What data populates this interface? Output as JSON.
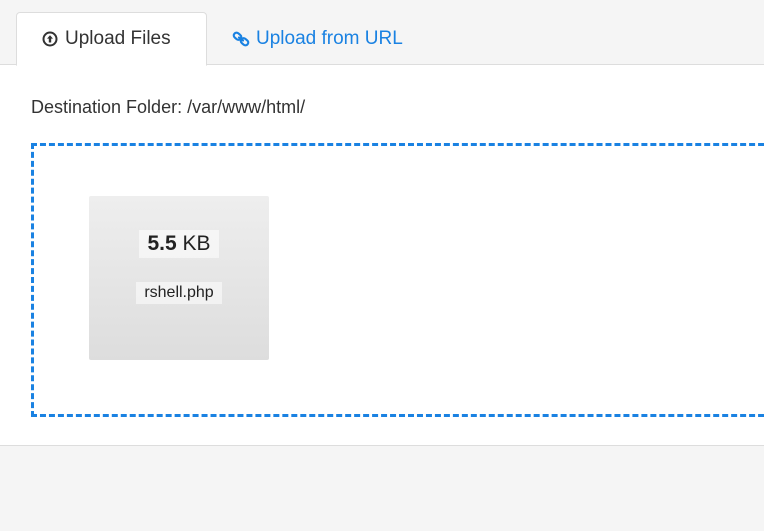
{
  "tabs": [
    {
      "label": "Upload Files",
      "icon": "upload-circle-icon",
      "active": true
    },
    {
      "label": "Upload from URL",
      "icon": "link-icon",
      "active": false
    }
  ],
  "destination": {
    "text": "Destination Folder: /var/www/html/"
  },
  "file": {
    "size_value": "5.5",
    "size_unit": "KB",
    "name": "rshell.php"
  },
  "colors": {
    "accent": "#1a82e2",
    "border": "#dddddd",
    "background": "#f5f5f5"
  }
}
